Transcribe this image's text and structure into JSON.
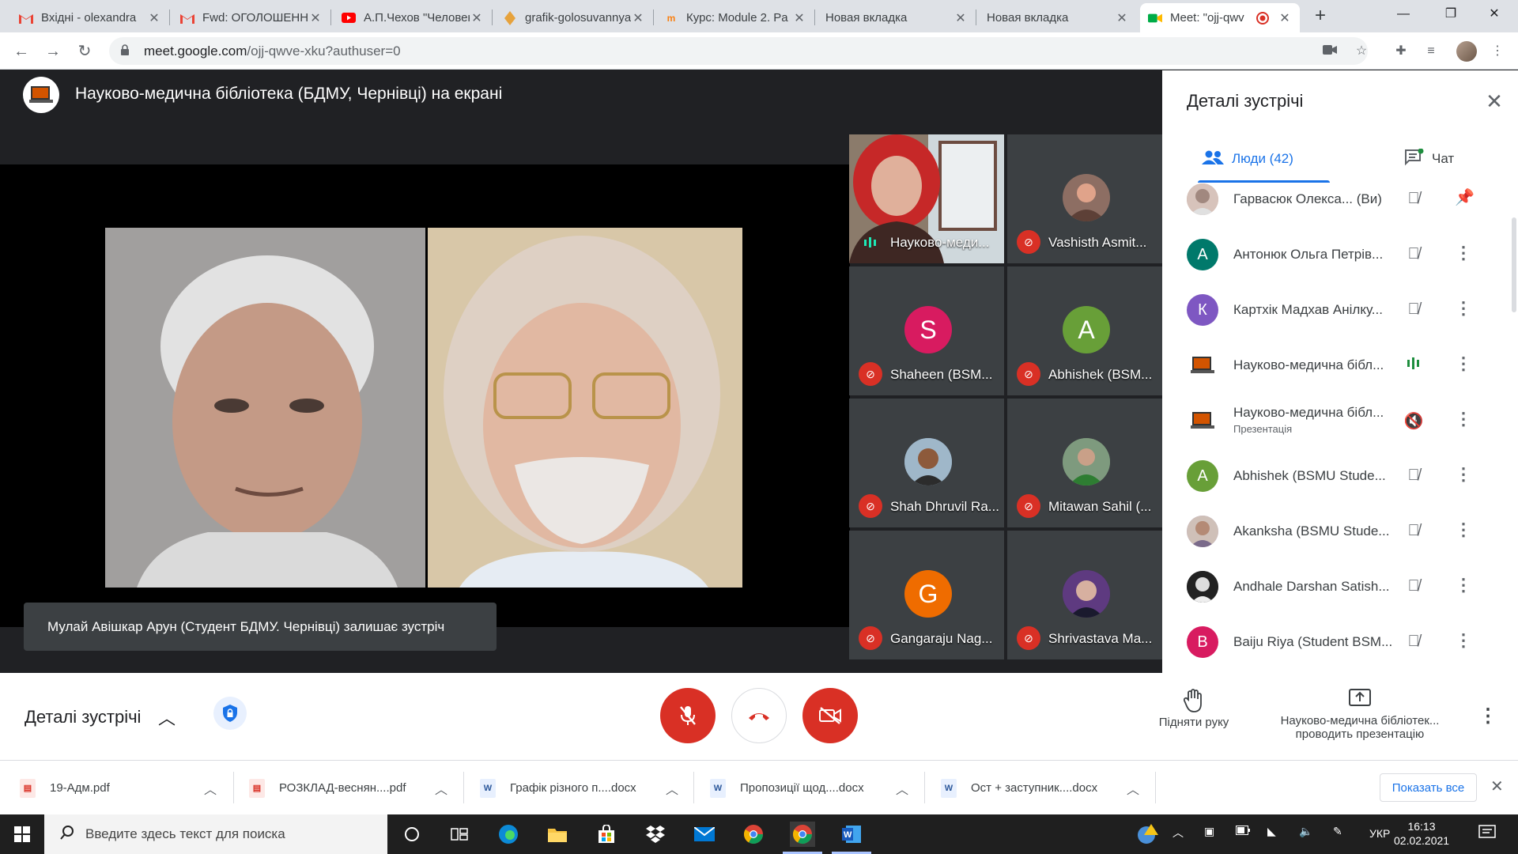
{
  "browser": {
    "tabs": [
      {
        "title": "Вхідні - olexandra",
        "icon": "gmail-icon"
      },
      {
        "title": "Fwd: ОГОЛОШЕННЯ",
        "icon": "gmail-icon"
      },
      {
        "title": "А.П.Чехов \"Человек",
        "icon": "youtube-icon"
      },
      {
        "title": "grafik-golosuvannya",
        "icon": "doc-icon"
      },
      {
        "title": "Курс: Module 2. Pa",
        "icon": "moodle-icon"
      },
      {
        "title": "Новая вкладка",
        "icon": ""
      },
      {
        "title": "Новая вкладка",
        "icon": ""
      },
      {
        "title": "Meet: \"ojj-qwv",
        "icon": "meet-icon"
      }
    ],
    "url_host": "meet.google.com",
    "url_path": "/ojj-qwve-xku?authuser=0"
  },
  "meet": {
    "presenter_title": "Науково-медична бібліотека (БДМУ, Чернівці) на екрані",
    "caption": "Мулай Авішкар Арун (Студент БДМУ. Чернівці) залишає зустріч",
    "tiles": [
      {
        "name": "Науково-меди...",
        "avatar": "",
        "color": ""
      },
      {
        "name": "Vashisth Asmit...",
        "avatar": "",
        "color": "#8d6e63"
      },
      {
        "name": "Shaheen (BSM...",
        "avatar": "S",
        "color": "#d81b60"
      },
      {
        "name": "Abhishek (BSM...",
        "avatar": "A",
        "color": "#689f38"
      },
      {
        "name": "Shah Dhruvil Ra...",
        "avatar": "",
        "color": "#6d8aa8"
      },
      {
        "name": "Mitawan Sahil (...",
        "avatar": "",
        "color": "#5c7a5c"
      },
      {
        "name": "Gangaraju Nag...",
        "avatar": "G",
        "color": "#ef6c00"
      },
      {
        "name": "Shrivastava Ma...",
        "avatar": "",
        "color": "#4a2d6b"
      }
    ]
  },
  "panel": {
    "title": "Деталі зустрічі",
    "tab_people": "Люди (42)",
    "tab_chat": "Чат",
    "participants": [
      {
        "name": "Гарвасюк Олекса...",
        "you": "(Ви)",
        "sub": "",
        "avatar": "",
        "color": "#c9a89b"
      },
      {
        "name": "Антонюк Ольга Петрів...",
        "you": "",
        "sub": "",
        "avatar": "А",
        "color": "#00796b"
      },
      {
        "name": "Картхік Мадхав Анілку...",
        "you": "",
        "sub": "",
        "avatar": "К",
        "color": "#7e57c2"
      },
      {
        "name": "Науково-медична бібл...",
        "you": "",
        "sub": "",
        "avatar": "",
        "color": "#e0e0e0"
      },
      {
        "name": "Науково-медична бібл...",
        "you": "",
        "sub": "Презентація",
        "avatar": "",
        "color": "#e0e0e0"
      },
      {
        "name": "Abhishek (BSMU Stude...",
        "you": "",
        "sub": "",
        "avatar": "A",
        "color": "#689f38"
      },
      {
        "name": "Akanksha (BSMU Stude...",
        "you": "",
        "sub": "",
        "avatar": "",
        "color": "#b39ddb"
      },
      {
        "name": "Andhale Darshan Satish...",
        "you": "",
        "sub": "",
        "avatar": "",
        "color": "#424242"
      },
      {
        "name": "Baiju Riya (Student BSM...",
        "you": "",
        "sub": "",
        "avatar": "B",
        "color": "#d81b60"
      }
    ]
  },
  "controls": {
    "details_label": "Деталі зустрічі",
    "raise_hand": "Підняти руку",
    "presenting_line1": "Науково-медична бібліотек...",
    "presenting_line2": "проводить презентацію"
  },
  "downloads": {
    "items": [
      {
        "name": "19-Адм.pdf",
        "type": "pdf"
      },
      {
        "name": "РОЗКЛАД-веснян....pdf",
        "type": "pdf"
      },
      {
        "name": "Графік різного п....docx",
        "type": "docx"
      },
      {
        "name": "Пропозиції щод....docx",
        "type": "docx"
      },
      {
        "name": "Ост + заступник....docx",
        "type": "docx"
      }
    ],
    "show_all": "Показать все"
  },
  "taskbar": {
    "search_placeholder": "Введите здесь текст для поиска",
    "lang": "УКР",
    "time": "16:13",
    "date": "02.02.2021"
  },
  "colors": {
    "meet_red": "#ea4335",
    "accent_blue": "#1a73e8",
    "meet_bg": "#202124"
  }
}
